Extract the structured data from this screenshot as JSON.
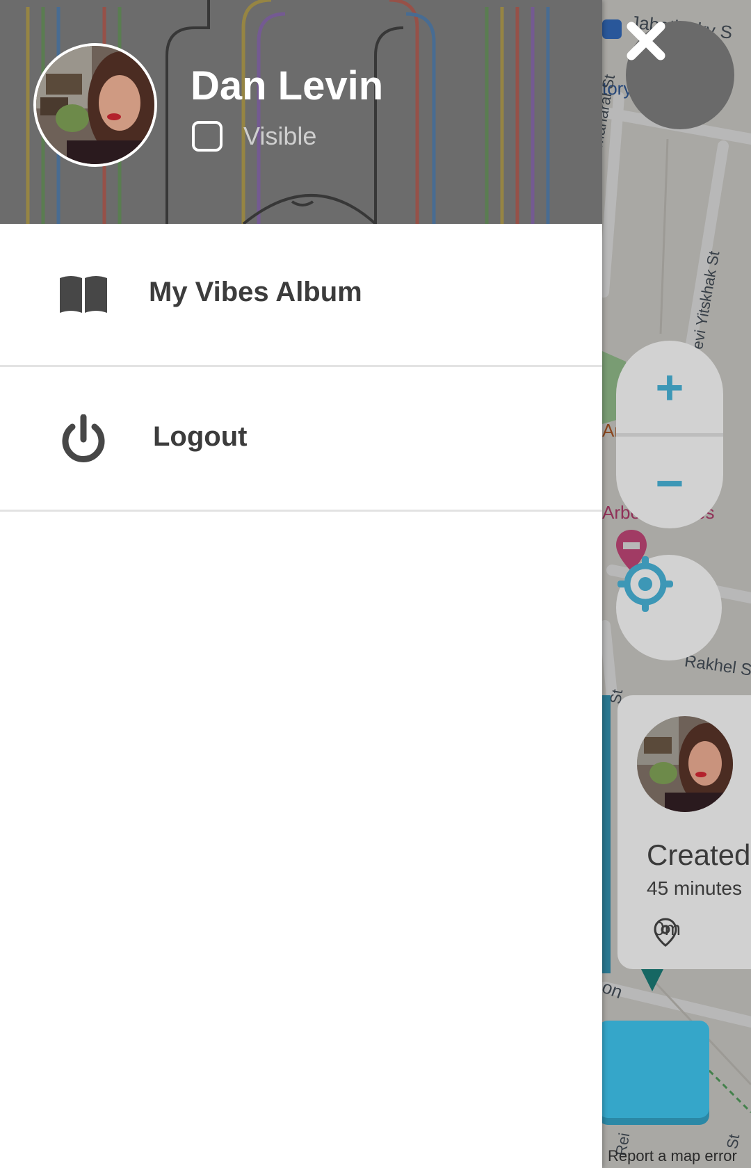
{
  "profile": {
    "name": "Dan Levin",
    "visibility_label": "Visible",
    "visible_checked": false
  },
  "menu": {
    "items": [
      {
        "label": "My Vibes Album",
        "icon": "book-icon"
      },
      {
        "label": "Logout",
        "icon": "power-icon"
      }
    ]
  },
  "map": {
    "street_labels": [
      "Jabotinsky S",
      "tory",
      "Maharal St",
      "evi Yitskhak St",
      "Ar",
      "Arbe",
      "es",
      "Rakhel S",
      "St",
      "on",
      "Rei",
      "St"
    ],
    "report_error": "Report a map error"
  },
  "controls": {
    "zoom_in": "+",
    "zoom_out": "−",
    "close": "✕"
  },
  "card": {
    "title": "Created",
    "time": "45 minutes",
    "distance": "0m"
  },
  "colors": {
    "accent_blue": "#35a6c9",
    "map_control_blue": "#3d97b6",
    "drawer_text": "#3c3c3c"
  }
}
